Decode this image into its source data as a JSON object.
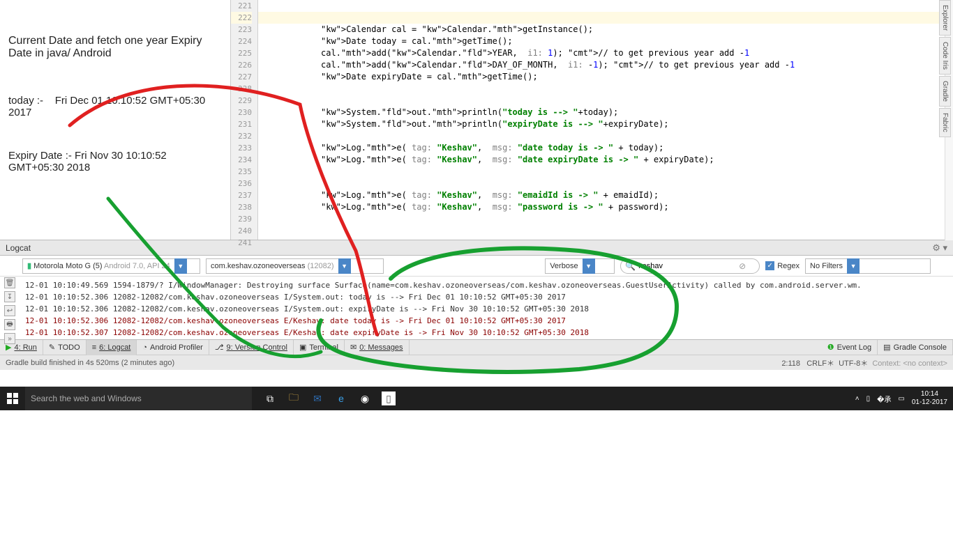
{
  "notes": {
    "title": "Current Date and fetch one year Expiry Date in java/ Android",
    "today_label": "today :-",
    "today_value": "Fri Dec 01 10:10:52 GMT+05:30 2017",
    "expiry_label": "Expiry Date :-",
    "expiry_value": "Fri Nov 30 10:10:52 GMT+05:30 2018"
  },
  "gutter": {
    "start": 221,
    "end": 241,
    "highlight": 222
  },
  "code": [
    "",
    "",
    "Calendar cal = Calendar.getInstance();",
    "Date today = cal.getTime();",
    "cal.add(Calendar.YEAR,  i1: 1); // to get previous year add -1",
    "cal.add(Calendar.DAY_OF_MONTH,  i1: -1); // to get previous year add -1",
    "Date expiryDate = cal.getTime();",
    "",
    "",
    "System.out.println(\"today is --> \"+today);",
    "System.out.println(\"expiryDate is --> \"+expiryDate);",
    "",
    "Log.e( tag: \"Keshav\",  msg: \"date today is -> \" + today);",
    "Log.e( tag: \"Keshav\",  msg: \"date expiryDate is -> \" + expiryDate);",
    "",
    "",
    "Log.e( tag: \"Keshav\",  msg: \"emaidId is -> \" + emaidId);",
    "Log.e( tag: \"Keshav\",  msg: \"password is -> \" + password);",
    "",
    "",
    ""
  ],
  "sidetabs": [
    "Explorer",
    "Code Iris",
    "Gradle",
    "Fabric"
  ],
  "logcat": {
    "title": "Logcat",
    "device": "Motorola Moto G (5)",
    "device_sub": "Android 7.0, API 24",
    "process": "com.keshav.ozoneoverseas",
    "process_sub": "(12082)",
    "level": "Verbose",
    "search": "keshav",
    "regex": "Regex",
    "filter": "No Filters",
    "lines": [
      {
        "cls": "",
        "txt": "12-01 10:10:49.569 1594-1879/? I/WindowManager: Destroying surface Surface(name=com.keshav.ozoneoverseas/com.keshav.ozoneoverseas.GuestUserActivity) called by com.android.server.wm."
      },
      {
        "cls": "",
        "txt": "12-01 10:10:52.306 12082-12082/com.keshav.ozoneoverseas I/System.out: today is --> Fri Dec 01 10:10:52 GMT+05:30 2017"
      },
      {
        "cls": "",
        "txt": "12-01 10:10:52.306 12082-12082/com.keshav.ozoneoverseas I/System.out: expiryDate is --> Fri Nov 30 10:10:52 GMT+05:30 2018"
      },
      {
        "cls": "err",
        "txt": "12-01 10:10:52.306 12082-12082/com.keshav.ozoneoverseas E/Keshav: date today is -> Fri Dec 01 10:10:52 GMT+05:30 2017"
      },
      {
        "cls": "err",
        "txt": "12-01 10:10:52.307 12082-12082/com.keshav.ozoneoverseas E/Keshav: date expiryDate is -> Fri Nov 30 10:10:52 GMT+05:30 2018"
      }
    ]
  },
  "bottom_tabs": {
    "run": "4: Run",
    "todo": "TODO",
    "logcat": "6: Logcat",
    "profiler": "Android Profiler",
    "vcs": "9: Version Control",
    "terminal": "Terminal",
    "messages": "0: Messages",
    "eventlog": "Event Log",
    "gradlec": "Gradle Console"
  },
  "status": {
    "msg": "Gradle build finished in 4s 520ms (2 minutes ago)",
    "pos": "2:118",
    "crlf": "CRLF",
    "enc": "UTF-8",
    "ctx": "Context: <no context>"
  },
  "taskbar": {
    "search_placeholder": "Search the web and Windows",
    "time": "10:14",
    "date": "01-12-2017"
  }
}
